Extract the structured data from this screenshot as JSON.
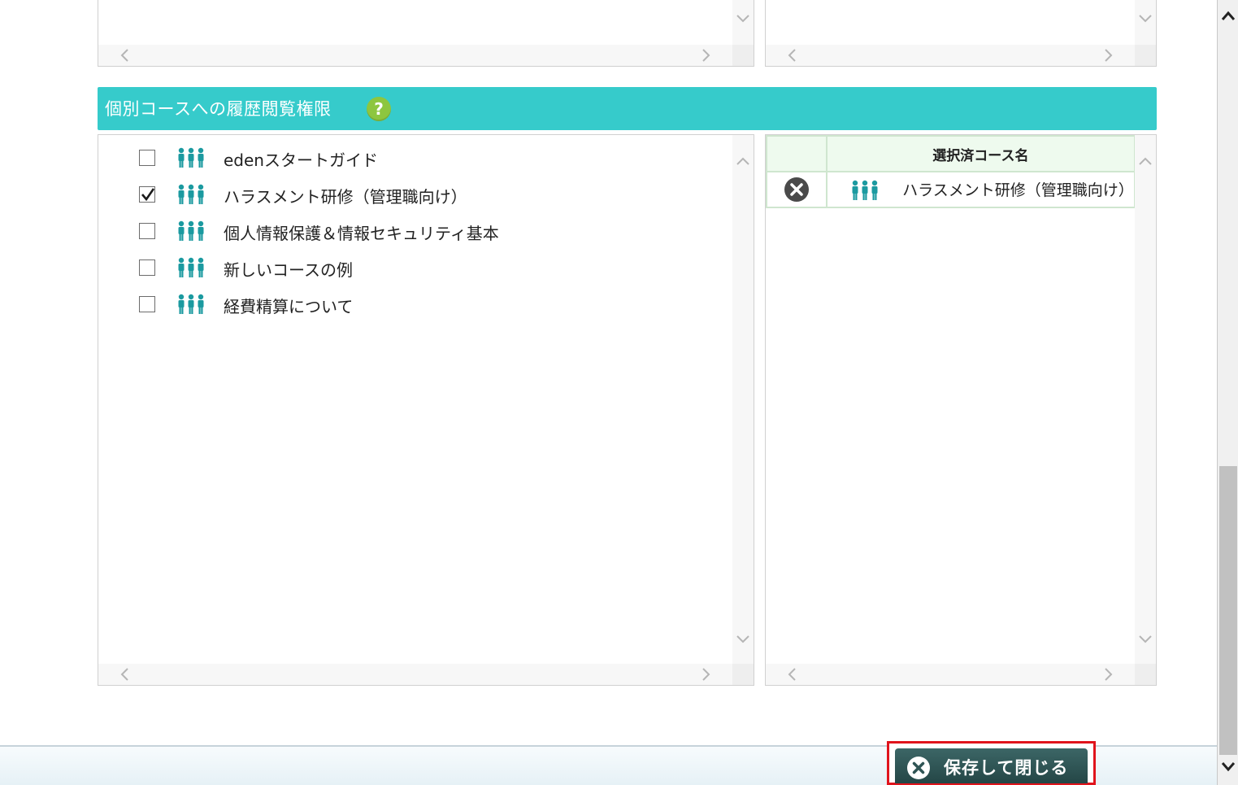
{
  "section": {
    "title": "個別コースへの履歴閲覧権限",
    "help_icon": "question-mark-icon",
    "help_color": "#8dc63f",
    "header_color": "#36cbcb"
  },
  "course_list": [
    {
      "label": "edenスタートガイド",
      "checked": false
    },
    {
      "label": "ハラスメント研修（管理職向け）",
      "checked": true
    },
    {
      "label": "個人情報保護＆情報セキュリティ基本",
      "checked": false
    },
    {
      "label": "新しいコースの例",
      "checked": false
    },
    {
      "label": "経費精算について",
      "checked": false
    }
  ],
  "selected_table": {
    "header": "選択済コース名",
    "rows": [
      {
        "name": "ハラスメント研修（管理職向け）",
        "remove_icon": "remove-circle-icon"
      }
    ]
  },
  "footer": {
    "save_close_label": "保存して閉じる",
    "save_icon": "close-circle-icon",
    "highlight_color": "#e0141c"
  },
  "icons": {
    "course": "group-people-icon",
    "people_color": "#1b9aa0"
  }
}
